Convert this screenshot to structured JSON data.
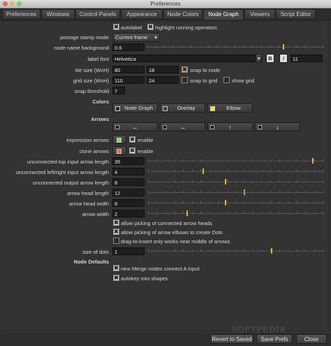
{
  "window": {
    "title": "Preferences"
  },
  "tabs": [
    "Preferences",
    "Windows",
    "Control Panels",
    "Appearance",
    "Node Colors",
    "Node Graph",
    "Viewers",
    "Script Editor"
  ],
  "node_graph": {
    "autolabel": "autolabel",
    "highlight": "highlight running operators",
    "postage_stamp_mode": {
      "label": "postage stamp mode",
      "value": "Current frame"
    },
    "node_name_background": {
      "label": "node name background",
      "value": "0.6"
    },
    "label_font": {
      "label": "label font",
      "value": "Helvetica",
      "bold": "B",
      "italic": "I",
      "size": "11"
    },
    "tile_size": {
      "label": "tile size (WxH)",
      "w": "80",
      "h": "18",
      "snap": "snap to node"
    },
    "grid_size": {
      "label": "grid size (WxH)",
      "w": "110",
      "h": "24",
      "snap": "snap to grid",
      "show": "show grid"
    },
    "snap_threshold": {
      "label": "snap threshold",
      "value": "7"
    },
    "colors_heading": "Colors",
    "color_buttons": [
      "Node Graph",
      "Overlay",
      "Elbow"
    ],
    "arrows_heading": "Arrows",
    "arrow_buttons": [
      "←",
      "→",
      "↑",
      "↓"
    ],
    "expression_arrows": {
      "label": "expression arrows",
      "enable": "enable"
    },
    "clone_arrows": {
      "label": "clone arrows",
      "enable": "enable"
    },
    "arrow_fields": [
      {
        "label": "unconnected top input arrow length",
        "value": "35"
      },
      {
        "label": "unconnected left/right input arrow length",
        "value": "4"
      },
      {
        "label": "unconnected output arrow length",
        "value": "8"
      },
      {
        "label": "arrow head length",
        "value": "12"
      },
      {
        "label": "arrow head width",
        "value": "8"
      },
      {
        "label": "arrow width",
        "value": "2"
      }
    ],
    "allow_heads": "allow picking of connected arrow heads",
    "allow_elbows": "allow picking of arrow elbows to create Dots",
    "drag_insert": "drag-to-insert only works near middle of arrows",
    "size_of_dots": {
      "label": "size of dots",
      "value": "1"
    },
    "node_defaults_heading": "Node Defaults",
    "merge_default": "new Merge nodes connect A input",
    "autokey": "autokey roto shapes"
  },
  "footer": {
    "revert": "Revert to Saved",
    "save": "Save Prefs",
    "close": "Close"
  },
  "watermark": "SOFTPEDIA",
  "colors": {
    "expression_swatch": "#7ed36a",
    "clone_swatch": "#d9714f",
    "elbow_swatch": "#ffe600",
    "slider_knob": "#e3b23c"
  }
}
